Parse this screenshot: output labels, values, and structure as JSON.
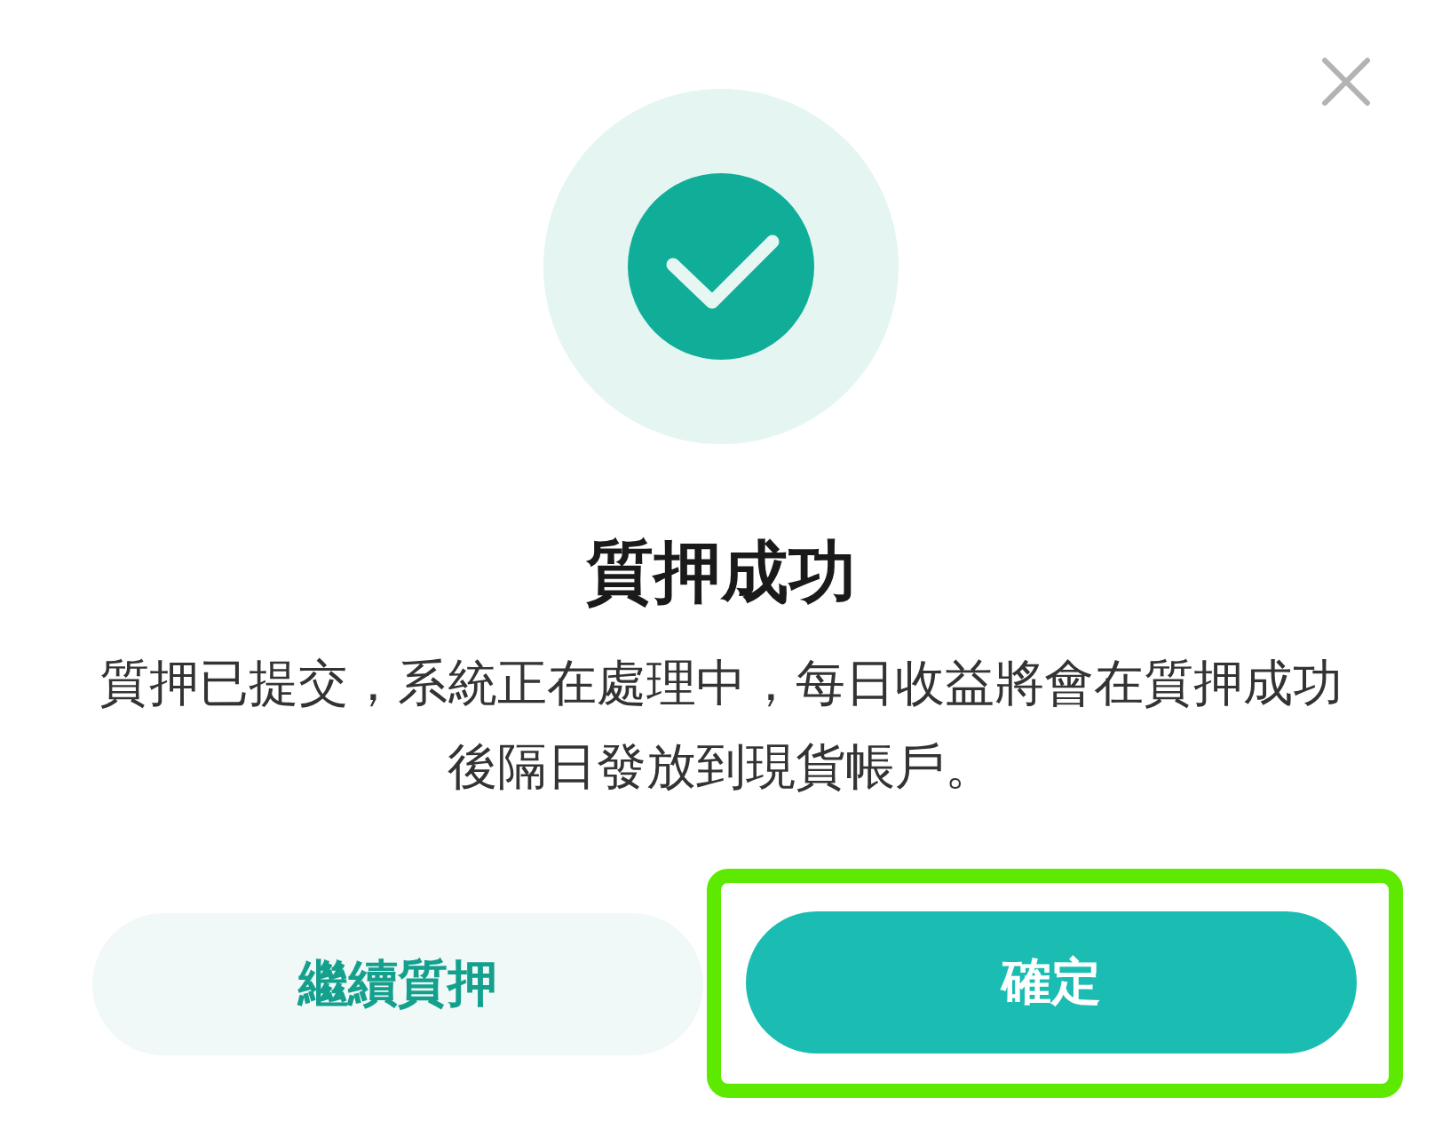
{
  "dialog": {
    "title": "質押成功",
    "message": "質押已提交，系統正在處理中，每日收益將會在質押成功後隔日發放到現貨帳戶。"
  },
  "buttons": [
    {
      "label": "繼續質押",
      "kind": "secondary",
      "highlighted": false
    },
    {
      "label": "確定",
      "kind": "primary",
      "highlighted": true
    }
  ]
}
